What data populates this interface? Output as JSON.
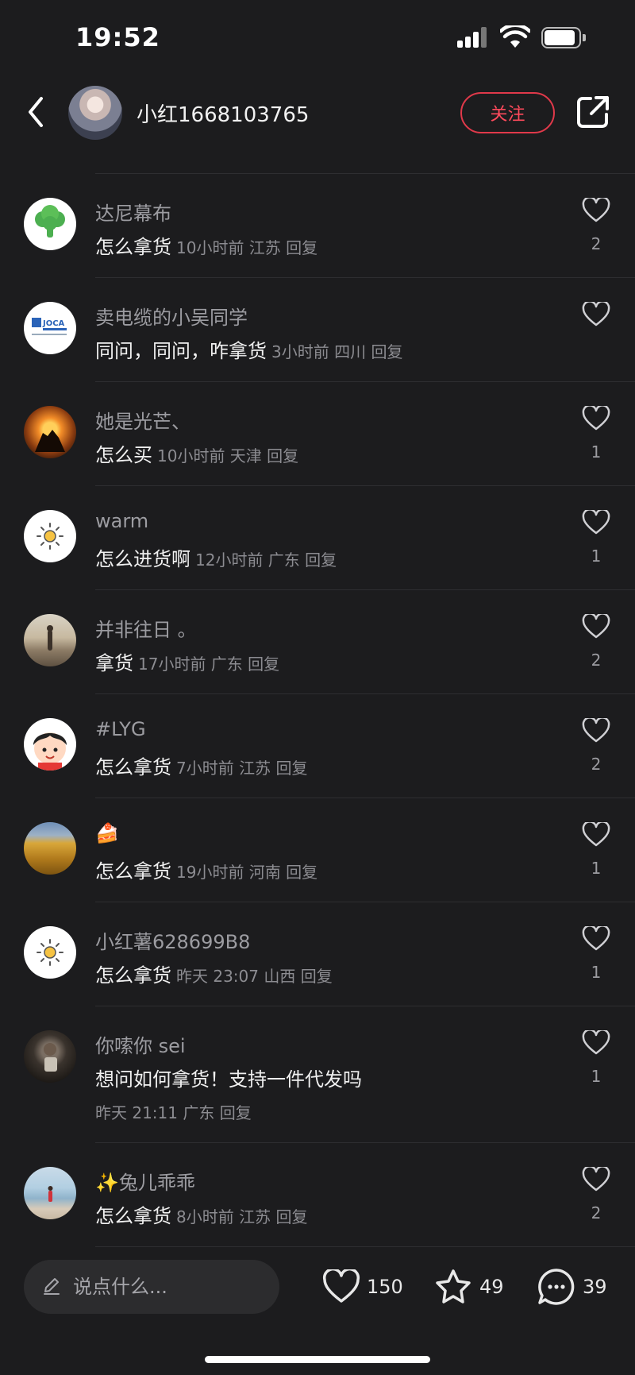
{
  "status_bar": {
    "time": "19:52"
  },
  "header": {
    "username": "小红1668103765",
    "follow_label": "关注"
  },
  "comments": [
    {
      "name": "达尼幕布",
      "text": "怎么拿货",
      "meta": "10小时前 江苏 回复",
      "likes": "2",
      "avatar": "broccoli-avatar"
    },
    {
      "name": "卖电缆的小吴同学",
      "text": "同问，同问，咋拿货",
      "meta": "3小时前 四川 回复",
      "likes": "",
      "avatar": "joca-logo-avatar"
    },
    {
      "name": "她是光芒、",
      "text": "怎么买",
      "meta": "10小时前 天津 回复",
      "likes": "1",
      "avatar": "sunset-avatar"
    },
    {
      "name": "warm",
      "text": "怎么进货啊",
      "meta": "12小时前 广东 回复",
      "likes": "1",
      "avatar": "sun-avatar"
    },
    {
      "name": "并非往日 。",
      "text": "拿货",
      "meta": "17小时前 广东 回复",
      "likes": "2",
      "avatar": "beach-avatar"
    },
    {
      "name": "#LYG",
      "text": "怎么拿货",
      "meta": "7小时前 江苏 回复",
      "likes": "2",
      "avatar": "cartoon-avatar"
    },
    {
      "name": "🍰",
      "text": "怎么拿货",
      "meta": "19小时前 河南 回复",
      "likes": "1",
      "avatar": "wheat-avatar"
    },
    {
      "name": "小红薯628699B8",
      "text": "怎么拿货",
      "meta": "昨天 23:07 山西 回复",
      "likes": "1",
      "avatar": "sun-avatar"
    },
    {
      "name": "你嗦你 sei",
      "text": "想问如何拿货！支持一件代发吗",
      "meta": "昨天 21:11 广东 回复",
      "likes": "1",
      "avatar": "person-avatar"
    },
    {
      "name": "✨兔儿乖乖",
      "text": "怎么拿货",
      "meta": "8小时前 江苏 回复",
      "likes": "2",
      "avatar": "sea-avatar"
    }
  ],
  "bottom_bar": {
    "input_placeholder": "说点什么...",
    "likes_count": "150",
    "favorites_count": "49",
    "comments_count": "39"
  },
  "colors": {
    "accent": "#ff4a5c",
    "background": "#1c1c1e"
  }
}
